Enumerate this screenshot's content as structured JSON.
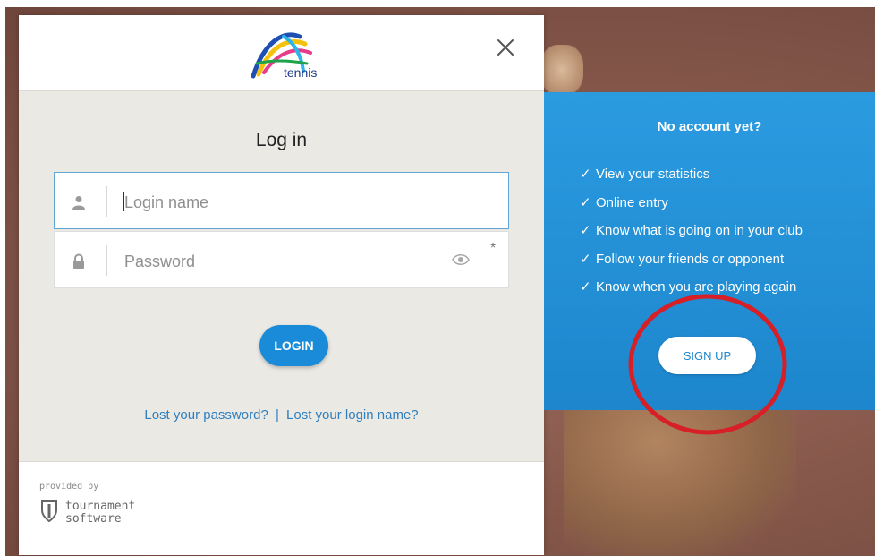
{
  "brand": {
    "logo_text": "tennis"
  },
  "login": {
    "title": "Log in",
    "username_placeholder": "Login name",
    "password_placeholder": "Password",
    "required_marker": "*",
    "submit_label": "LOGIN",
    "lost_password_link": "Lost your password?",
    "link_separator": "|",
    "lost_login_link": "Lost your login name?"
  },
  "footer": {
    "provided_by": "provided by",
    "provider_line1": "tournament",
    "provider_line2": "software"
  },
  "signup": {
    "title": "No account yet?",
    "check_mark": "✓",
    "benefits": [
      "View your statistics",
      "Online entry",
      "Know what is going on in your club",
      "Follow your friends or opponent",
      "Know when you are playing again"
    ],
    "button_label": "SIGN UP"
  },
  "colors": {
    "primary_blue": "#1a8bd8",
    "panel_blue": "#2b9be0",
    "card_bg": "#ebe9e4",
    "link_blue": "#2f7fbf",
    "annotation_red": "#d61f26"
  }
}
